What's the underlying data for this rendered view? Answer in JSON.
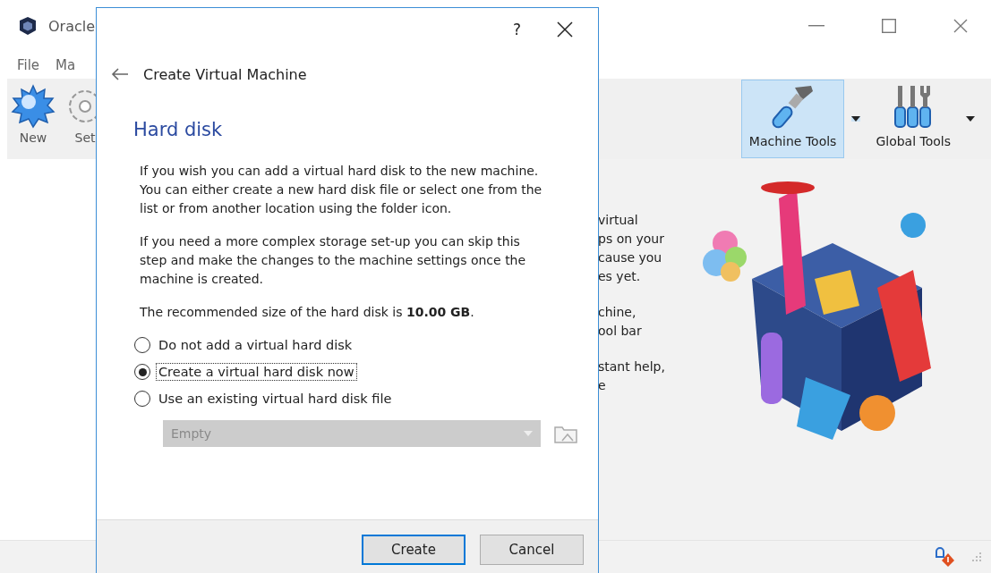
{
  "window": {
    "title": "Oracle"
  },
  "menu": [
    "File",
    "Ma"
  ],
  "toolbar": [
    {
      "label": "New",
      "kind": "new"
    },
    {
      "label": "Set",
      "kind": "settings"
    }
  ],
  "tools": [
    {
      "label": "Machine Tools",
      "kind": "machine",
      "selected": true
    },
    {
      "label": "Global Tools",
      "kind": "global",
      "selected": false
    }
  ],
  "welcome_text": [
    {
      "lines": [
        "virtual",
        "ps on your",
        "cause you",
        "es yet."
      ]
    },
    {
      "lines": [
        "chine,",
        "ool bar"
      ]
    },
    {
      "lines": [
        "stant help,",
        "e"
      ]
    }
  ],
  "dialog": {
    "help": "?",
    "title": "Create Virtual Machine",
    "heading": "Hard disk",
    "paragraphs": [
      "If you wish you can add a virtual hard disk to the new machine. You can either create a new hard disk file or select one from the list or from another location using the folder icon.",
      "If you need a more complex storage set-up you can skip this step and make the changes to the machine settings once the machine is created.",
      "The recommended size of the hard disk is **10.00 GB**."
    ],
    "options": [
      {
        "label": "Do not add a virtual hard disk",
        "selected": false,
        "focused": false
      },
      {
        "label": "Create a virtual hard disk now",
        "selected": true,
        "focused": true
      },
      {
        "label": "Use an existing virtual hard disk file",
        "selected": false,
        "focused": false
      }
    ],
    "disk_combo": {
      "value": "Empty",
      "disabled": true
    },
    "buttons": [
      {
        "label": "Create",
        "default": true
      },
      {
        "label": "Cancel",
        "default": false
      }
    ]
  }
}
